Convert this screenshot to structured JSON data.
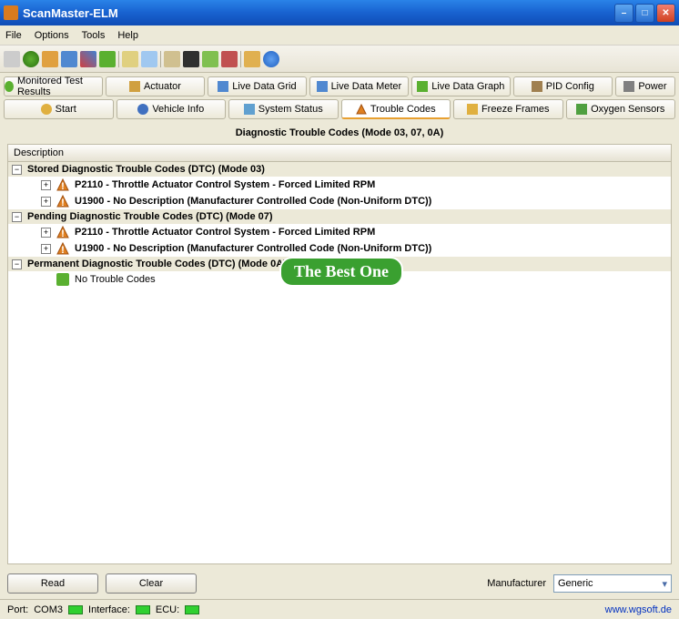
{
  "window": {
    "title": "ScanMaster-ELM"
  },
  "menu": [
    "File",
    "Options",
    "Tools",
    "Help"
  ],
  "tabs_top": [
    "Monitored Test Results",
    "Actuator",
    "Live Data Grid",
    "Live Data Meter",
    "Live Data Graph",
    "PID Config",
    "Power"
  ],
  "tabs_bottom": [
    "Start",
    "Vehicle Info",
    "System Status",
    "Trouble Codes",
    "Freeze Frames",
    "Oxygen Sensors"
  ],
  "panel": {
    "title": "Diagnostic Trouble Codes (Mode 03, 07, 0A)",
    "header": "Description",
    "groups": [
      {
        "label": "Stored Diagnostic Trouble Codes (DTC) (Mode 03)",
        "items": [
          "P2110 - Throttle Actuator Control System - Forced Limited RPM",
          "U1900 - No Description (Manufacturer Controlled Code (Non-Uniform DTC))"
        ]
      },
      {
        "label": "Pending Diagnostic Trouble Codes (DTC) (Mode 07)",
        "items": [
          "P2110 - Throttle Actuator Control System - Forced Limited RPM",
          "U1900 - No Description (Manufacturer Controlled Code (Non-Uniform DTC))"
        ]
      },
      {
        "label": "Permanent Diagnostic Trouble Codes (DTC) (Mode 0A)",
        "ok_items": [
          "No Trouble Codes"
        ]
      }
    ]
  },
  "watermark": "The Best One",
  "buttons": {
    "read": "Read",
    "clear": "Clear"
  },
  "manufacturer": {
    "label": "Manufacturer",
    "value": "Generic"
  },
  "status": {
    "port_label": "Port:",
    "port": "COM3",
    "if_label": "Interface:",
    "ecu_label": "ECU:",
    "url": "www.wgsoft.de"
  }
}
